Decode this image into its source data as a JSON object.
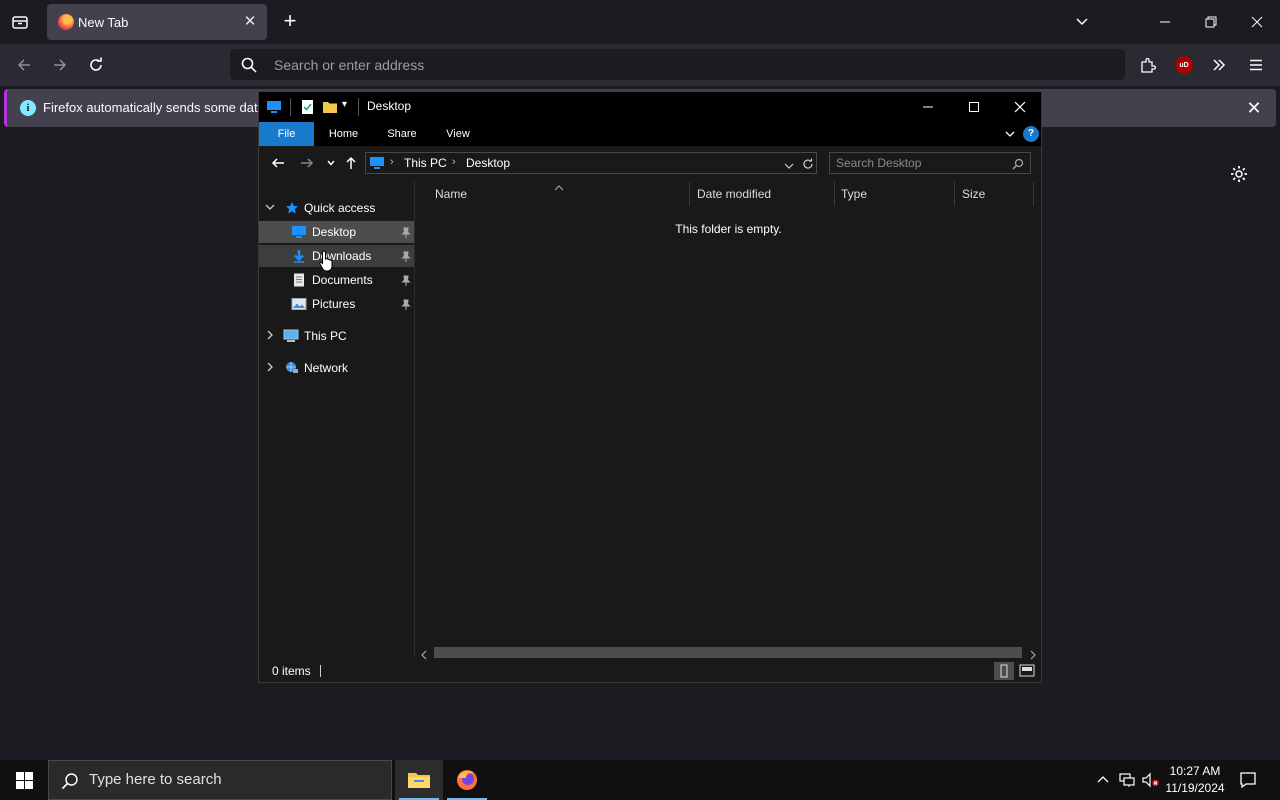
{
  "browser": {
    "tab_title": "New Tab",
    "address_placeholder": "Search or enter address",
    "ublock_label": "uD",
    "notification_text": "Firefox automatically sends some data to"
  },
  "explorer": {
    "title": "Desktop",
    "ribbon_tabs": [
      "File",
      "Home",
      "Share",
      "View"
    ],
    "help_label": "?",
    "breadcrumb": [
      "This PC",
      "Desktop"
    ],
    "search_placeholder": "Search Desktop",
    "nav": {
      "quick_access": "Quick access",
      "items": [
        "Desktop",
        "Downloads",
        "Documents",
        "Pictures"
      ],
      "this_pc": "This PC",
      "network": "Network"
    },
    "columns": [
      "Name",
      "Date modified",
      "Type",
      "Size"
    ],
    "empty_message": "This folder is empty.",
    "status": "0 items"
  },
  "taskbar": {
    "search_placeholder": "Type here to search",
    "time": "10:27 AM",
    "date": "11/19/2024"
  },
  "colors": {
    "accent_blue": "#1979ca",
    "firefox_bg": "#1c1b22",
    "explorer_bg": "#191919"
  }
}
